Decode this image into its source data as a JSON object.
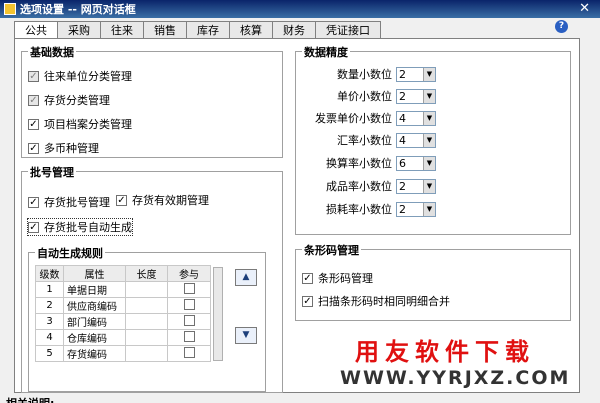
{
  "window": {
    "title": "选项设置 -- 网页对话框",
    "close": "✕"
  },
  "tabs": [
    {
      "label": "公共"
    },
    {
      "label": "采购"
    },
    {
      "label": "往来"
    },
    {
      "label": "销售"
    },
    {
      "label": "库存"
    },
    {
      "label": "核算"
    },
    {
      "label": "财务"
    },
    {
      "label": "凭证接口"
    }
  ],
  "help": "?",
  "basic": {
    "title": "基础数据",
    "items": [
      {
        "label": "往来单位分类管理",
        "checked": true,
        "disabled": true
      },
      {
        "label": "存货分类管理",
        "checked": true,
        "disabled": true
      },
      {
        "label": "项目档案分类管理",
        "checked": true,
        "disabled": false
      },
      {
        "label": "多币种管理",
        "checked": true,
        "disabled": false
      }
    ]
  },
  "batch": {
    "title": "批号管理",
    "items": [
      {
        "label": "存货批号管理",
        "checked": true
      },
      {
        "label": "存货有效期管理",
        "checked": true
      },
      {
        "label": "存货批号自动生成",
        "checked": true
      }
    ]
  },
  "rules": {
    "title": "自动生成规则",
    "headers": [
      "级数",
      "属性",
      "长度",
      "参与"
    ],
    "rows": [
      {
        "n": "1",
        "attr": "单据日期",
        "len": "",
        "join": false
      },
      {
        "n": "2",
        "attr": "供应商编码",
        "len": "",
        "join": false
      },
      {
        "n": "3",
        "attr": "部门编码",
        "len": "",
        "join": false
      },
      {
        "n": "4",
        "attr": "仓库编码",
        "len": "",
        "join": false
      },
      {
        "n": "5",
        "attr": "存货编码",
        "len": "",
        "join": false
      }
    ],
    "up": "▲",
    "down": "▼"
  },
  "precision": {
    "title": "数据精度",
    "items": [
      {
        "label": "数量小数位",
        "value": "2"
      },
      {
        "label": "单价小数位",
        "value": "2"
      },
      {
        "label": "发票单价小数位",
        "value": "4"
      },
      {
        "label": "汇率小数位",
        "value": "4"
      },
      {
        "label": "换算率小数位",
        "value": "6"
      },
      {
        "label": "成品率小数位",
        "value": "2"
      },
      {
        "label": "损耗率小数位",
        "value": "2"
      }
    ]
  },
  "barcode": {
    "title": "条形码管理",
    "items": [
      {
        "label": "条形码管理",
        "checked": true
      },
      {
        "label": "扫描条形码时相同明细合并",
        "checked": true
      }
    ]
  },
  "footer": {
    "label": "相关说明:"
  },
  "logo": {
    "text": "用友软件下载",
    "url": "WWW.YYRJXZ.COM"
  }
}
